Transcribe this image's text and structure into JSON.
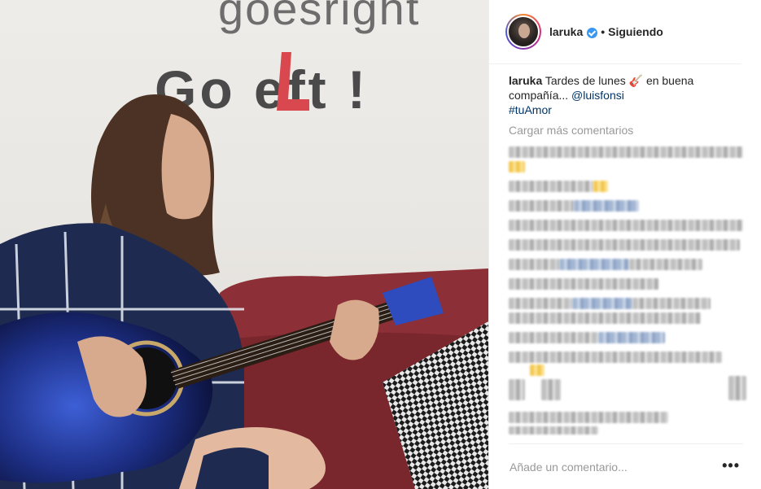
{
  "media": {
    "wall_top_text": "goesright",
    "wall_main_text": "Go  eft !"
  },
  "header": {
    "username": "laruka",
    "separator": "•",
    "follow_status": "Siguiendo"
  },
  "caption": {
    "username": "laruka",
    "text": " Tardes de lunes 🎸 en buena compañía... ",
    "mention": "@luisfonsi",
    "hashtag": "#tuAmor"
  },
  "load_more": "Cargar más comentarios",
  "comment_box": {
    "placeholder": "Añade un comentario...",
    "more_label": "•••"
  },
  "colors": {
    "verified_blue": "#3897f0",
    "link_blue": "#003569",
    "muted_gray": "#999999"
  }
}
